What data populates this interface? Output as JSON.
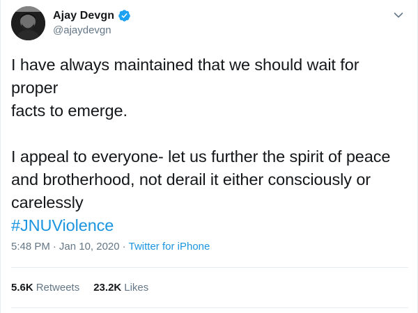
{
  "user": {
    "display_name": "Ajay Devgn",
    "handle": "@ajaydevgn",
    "verified": true,
    "avatar_icon": "avatar-photo"
  },
  "tweet": {
    "paragraph_1": "I have always maintained that we should wait for proper\nfacts to emerge.",
    "paragraph_2": "I appeal to everyone- let us further the spirit of peace\nand brotherhood, not derail it either consciously or\ncarelessly",
    "hashtag": "#JNUViolence"
  },
  "meta": {
    "time": "5:48 PM",
    "separator_1": "·",
    "date": "Jan 10, 2020",
    "separator_2": "·",
    "source": "Twitter for iPhone"
  },
  "stats": {
    "retweets_count": "5.6K",
    "retweets_label": "Retweets",
    "likes_count": "23.2K",
    "likes_label": "Likes"
  },
  "colors": {
    "link": "#1b95e0",
    "secondary_text": "#657786",
    "primary_text": "#14171a",
    "verified_badge": "#1da1f2",
    "divider": "#e6ecf0"
  }
}
